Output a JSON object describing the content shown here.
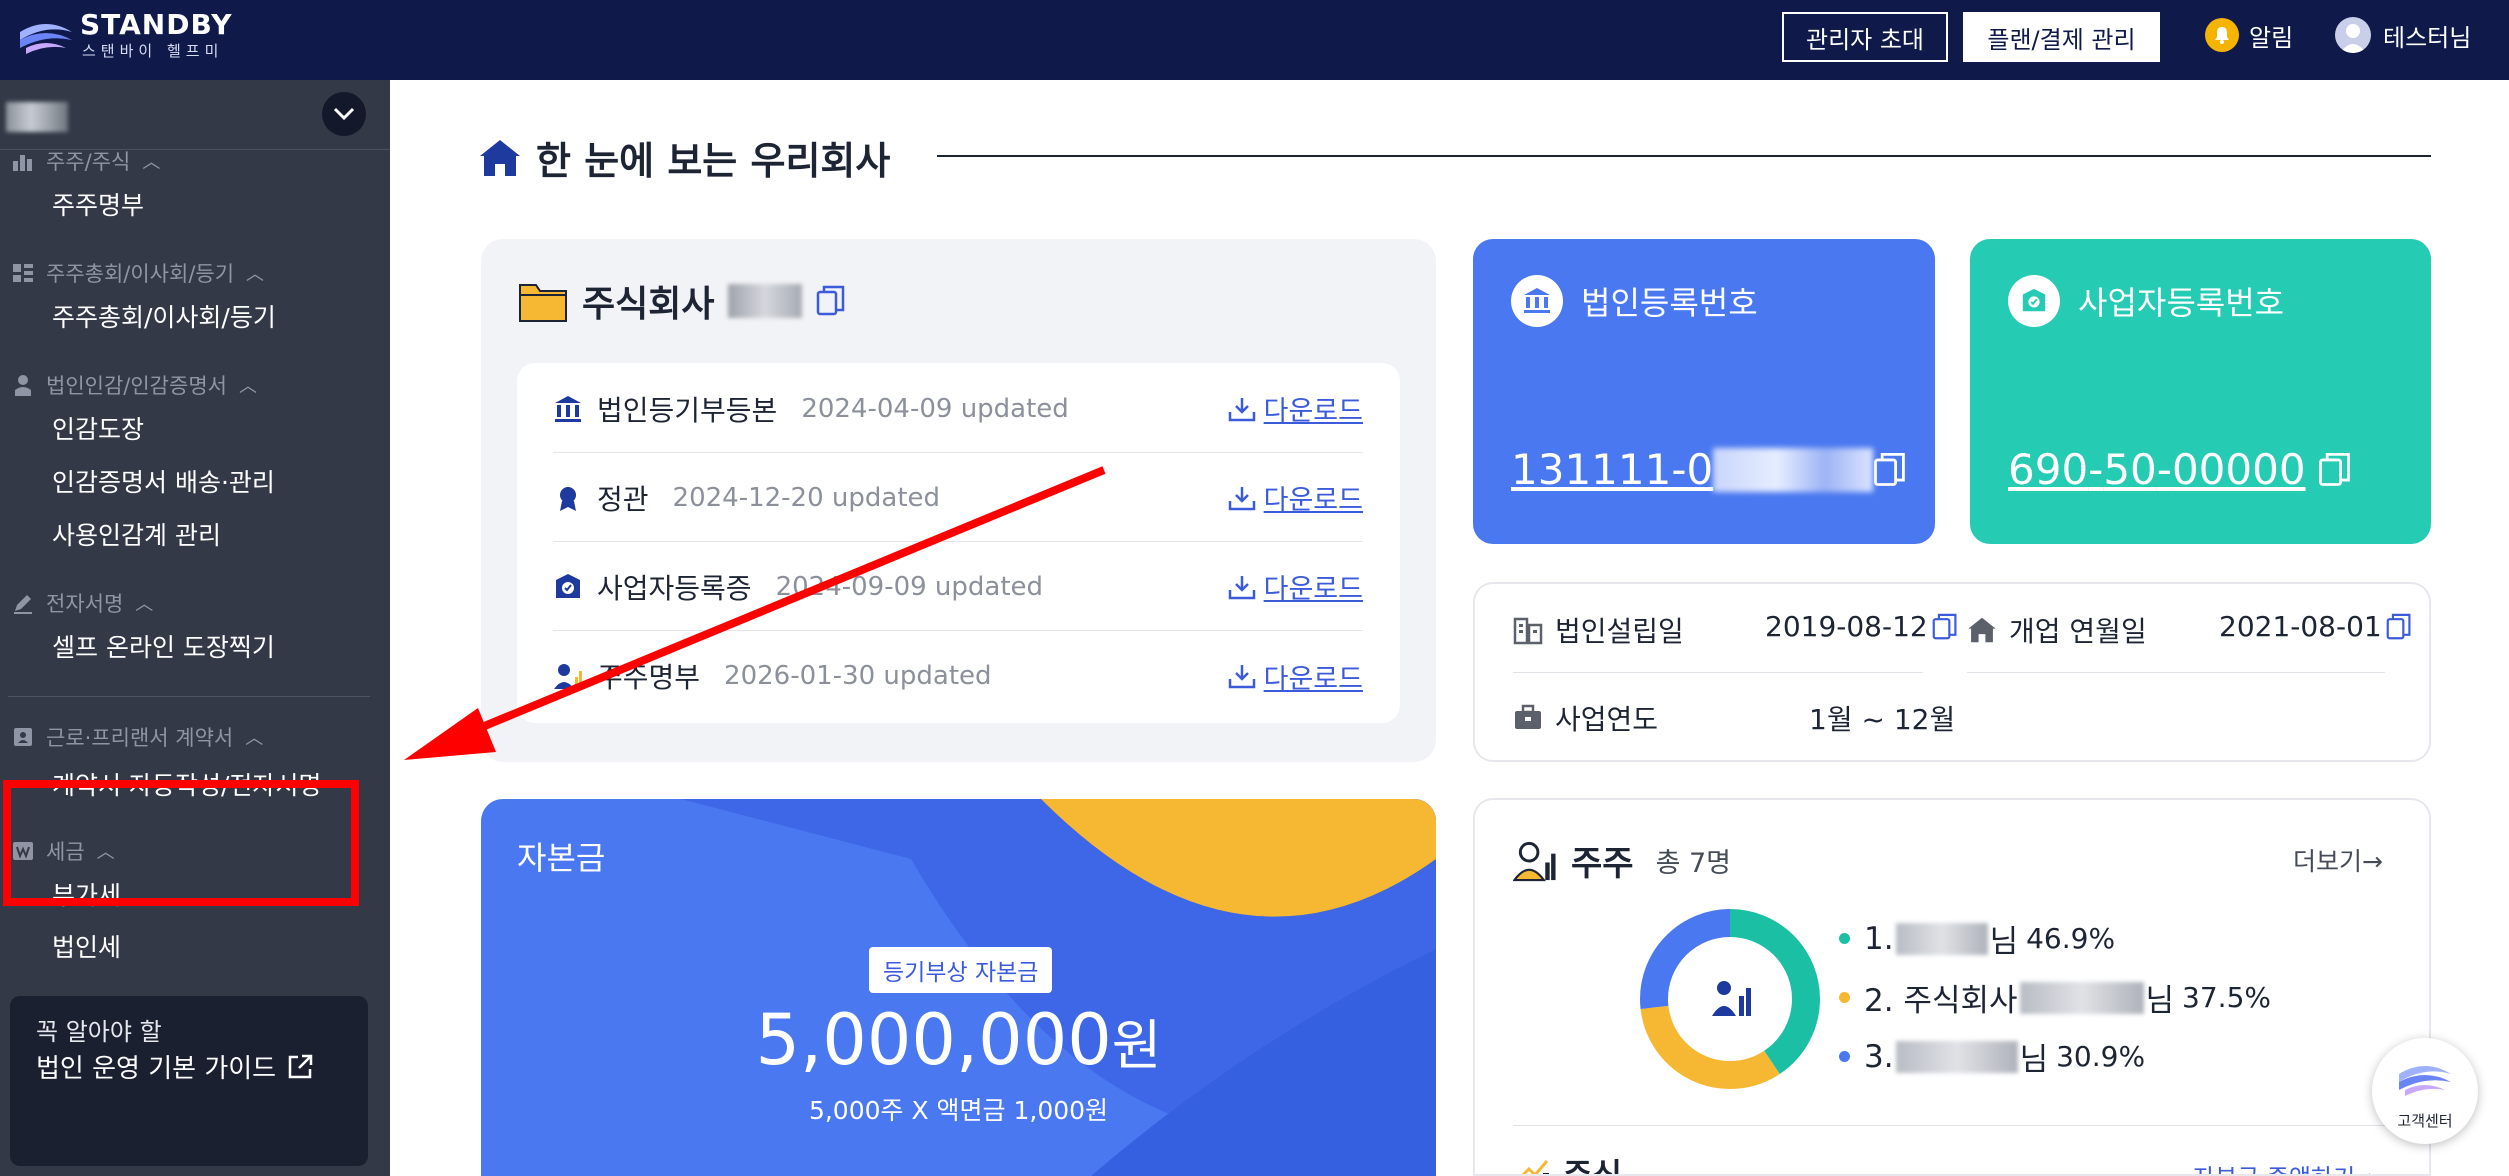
{
  "header": {
    "brand_title": "STANDBY",
    "brand_sub": "스탠바이 헬프미",
    "invite_label": "관리자 초대",
    "plan_label": "플랜/결제 관리",
    "alarm_label": "알림",
    "user_label": "테스터님"
  },
  "sidebar": {
    "sections": [
      {
        "title": "주주/주식",
        "items": [
          "주주명부"
        ]
      },
      {
        "title": "주주총회/이사회/등기",
        "items": [
          "주주총회/이사회/등기"
        ]
      },
      {
        "title": "법인인감/인감증명서",
        "items": [
          "인감도장",
          "인감증명서 배송·관리",
          "사용인감계 관리"
        ]
      },
      {
        "title": "전자서명",
        "items": [
          "셀프 온라인 도장찍기"
        ]
      },
      {
        "title": "근로·프리랜서 계약서",
        "items": [
          "계약서 자동작성/전자서명"
        ]
      },
      {
        "title": "세금",
        "items": [
          "부가세",
          "법인세"
        ]
      }
    ],
    "guide_line1": "꼭 알아야 할",
    "guide_line2": "법인 운영 기본 가이드"
  },
  "main": {
    "title": "한 눈에 보는 우리회사",
    "company_prefix": "주식회사",
    "documents": [
      {
        "name": "법인등기부등본",
        "updated": "2024-04-09 updated",
        "action": "다운로드"
      },
      {
        "name": "정관",
        "updated": "2024-12-20 updated",
        "action": "다운로드"
      },
      {
        "name": "사업자등록증",
        "updated": "2024-09-09 updated",
        "action": "다운로드"
      },
      {
        "name": "주주명부",
        "updated": "2026-01-30 updated",
        "action": "다운로드"
      }
    ],
    "corp_reg": {
      "label": "법인등록번호",
      "number": "131111-0"
    },
    "biz_reg": {
      "label": "사업자등록번호",
      "part1": "690",
      "part2": "50",
      "part3": "00000"
    },
    "info": {
      "est_label": "법인설립일",
      "est_value": "2019-08-12",
      "open_label": "개업 연월일",
      "open_value": "2021-08-01",
      "fy_label": "사업연도",
      "fy_value": "1월 ~ 12월"
    },
    "capital": {
      "title": "자본금",
      "badge": "등기부상 자본금",
      "amount": "5,000,000",
      "unit": "원",
      "sub": "5,000주 X 액면금 1,000원"
    },
    "shareholders": {
      "title": "주주",
      "count": "총 7명",
      "more": "더보기→",
      "list": [
        {
          "rank": "1.",
          "name_suffix": "님",
          "pct": "46.9%",
          "color": "#1bbfa4"
        },
        {
          "rank": "2. 주식회사",
          "name_suffix": "님",
          "pct": "37.5%",
          "color": "#f6b733"
        },
        {
          "rank": "3.",
          "name_suffix": "님",
          "pct": "30.9%",
          "color": "#4a78f0"
        }
      ],
      "donut": [
        46.9,
        37.5,
        30.9
      ]
    },
    "stock": {
      "title": "주식",
      "link": "자본금 증액하기→"
    }
  },
  "help": {
    "label": "고객센터"
  },
  "colors": {
    "header_bg": "#0f1a4a",
    "sidebar_bg": "#333946",
    "blue": "#4a78f0",
    "teal": "#26cbb4",
    "yellow": "#f6b733",
    "highlight": "#ff0000"
  }
}
